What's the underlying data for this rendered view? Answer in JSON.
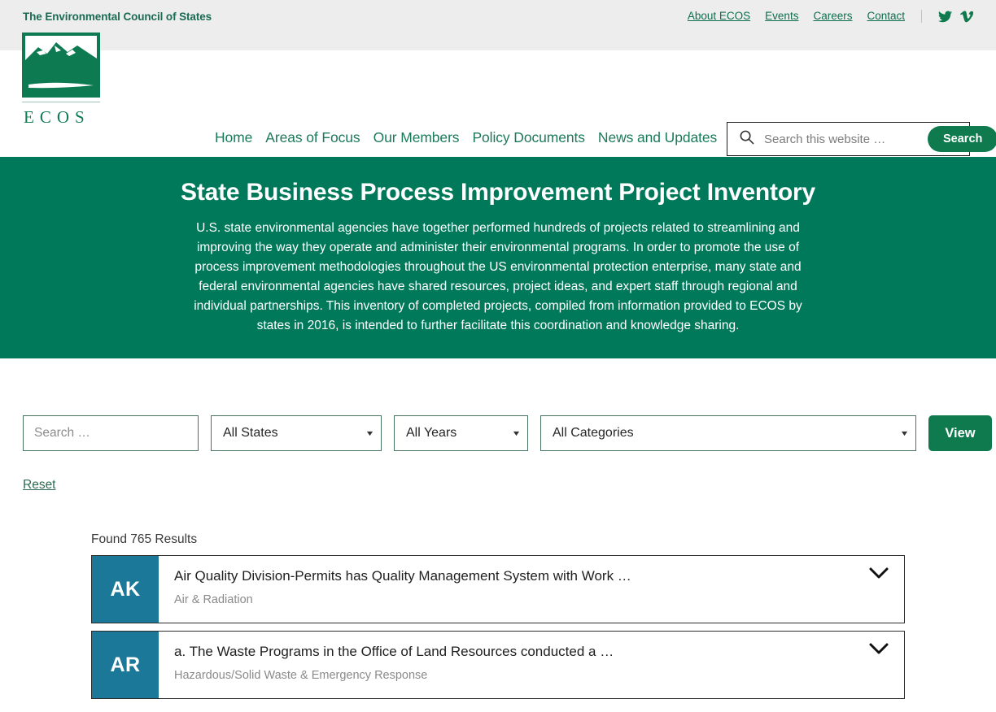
{
  "topbar": {
    "tagline": "The Environmental Council of States",
    "links": [
      {
        "label": "About ECOS"
      },
      {
        "label": "Events"
      },
      {
        "label": "Careers"
      },
      {
        "label": "Contact"
      }
    ],
    "social": [
      {
        "name": "twitter-icon"
      },
      {
        "name": "vimeo-icon"
      }
    ]
  },
  "brand": {
    "logo_text": "ECOS",
    "accent_green": "#0e7a52"
  },
  "nav": {
    "items": [
      {
        "label": "Home"
      },
      {
        "label": "Areas of Focus"
      },
      {
        "label": "Our Members"
      },
      {
        "label": "Policy Documents"
      },
      {
        "label": "News and Updates"
      }
    ]
  },
  "header_search": {
    "placeholder": "Search this website …",
    "value": "",
    "button_label": "Search"
  },
  "hero": {
    "title": "State Business Process Improvement Project Inventory",
    "body": "U.S. state environmental agencies have together performed hundreds of projects related to streamlining and improving the way they operate and administer their environmental programs. In order to promote the use of process improvement methodologies throughout the US environmental protection enterprise, many state and federal environmental agencies have shared resources, project ideas, and expert staff through regional and individual partnerships. This inventory of completed projects, compiled from information provided to ECOS by states in 2016, is intended to further facilitate this coordination and knowledge sharing.",
    "background": "#00795a"
  },
  "filters": {
    "search_placeholder": "Search …",
    "search_value": "",
    "states_selected": "All States",
    "years_selected": "All Years",
    "categories_selected": "All Categories",
    "view_label": "View",
    "reset_label": "Reset"
  },
  "results": {
    "count_text": "Found 765 Results",
    "items": [
      {
        "state": "AK",
        "title": "Air Quality Division-Permits has Quality Management System with Work …",
        "category": "Air & Radiation"
      },
      {
        "state": "AR",
        "title": "a. The Waste Programs in the Office of Land Resources conducted a …",
        "category": "Hazardous/Solid Waste & Emergency Response"
      }
    ],
    "badge_color": "#1b7899"
  }
}
